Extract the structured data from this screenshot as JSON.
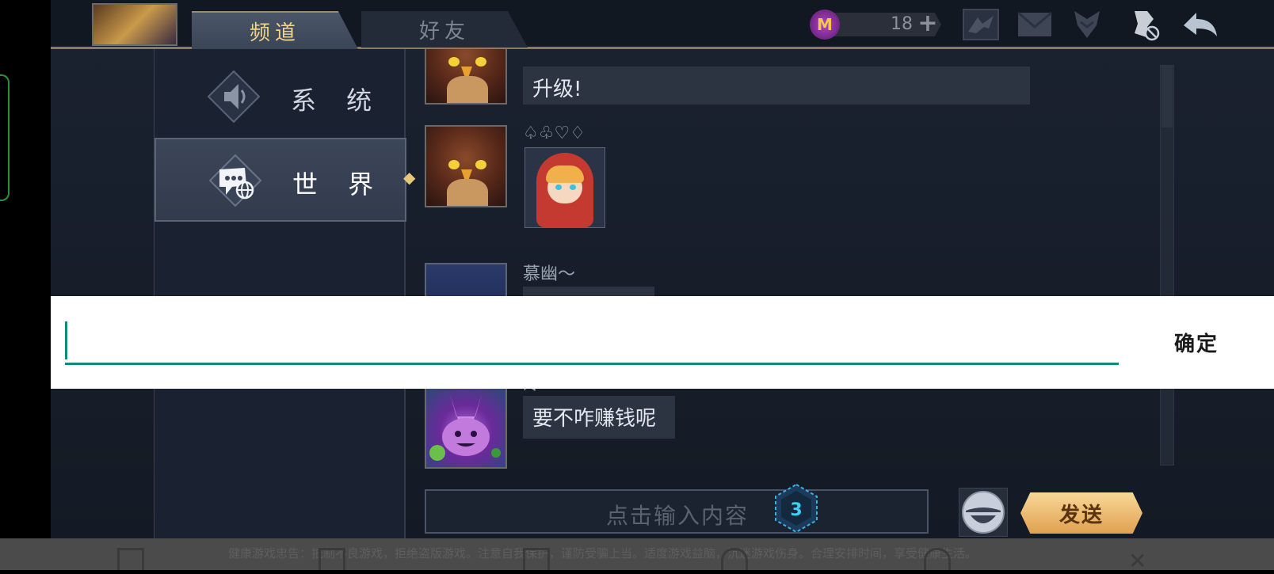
{
  "tabs": {
    "channels": "频道",
    "friends": "好友"
  },
  "currency": {
    "value": "18",
    "coin_symbol": "M",
    "plus": "+"
  },
  "top_icons": [
    "shark-icon",
    "mail-icon",
    "hero-icon",
    "mute-icon",
    "back-icon"
  ],
  "sidebar": {
    "items": [
      {
        "label": "系 统",
        "icon": "speaker-icon"
      },
      {
        "label": "世 界",
        "icon": "world-chat-icon"
      }
    ]
  },
  "chat": {
    "messages": [
      {
        "text": "升级!"
      },
      {
        "username": "♤♧♡♢",
        "sticker": "red-hood-sticker"
      },
      {
        "username": "慕幽〜"
      },
      {
        "username": "澪",
        "text": "要不咋赚钱呢"
      }
    ]
  },
  "input": {
    "placeholder": "点击输入内容",
    "badge": "3"
  },
  "send_label": "发送",
  "ime": {
    "confirm": "确定"
  },
  "footer": {
    "notice": "健康游戏忠告：抵制不良游戏，拒绝盗版游戏。注意自我保护，谨防受骗上当。适度游戏益脑，沉迷游戏伤身。合理安排时间，享受健康生活。"
  },
  "colors": {
    "accent_gold": "#f0d28a",
    "ime_teal": "#128a7a",
    "send_orange": "#e0a050"
  }
}
